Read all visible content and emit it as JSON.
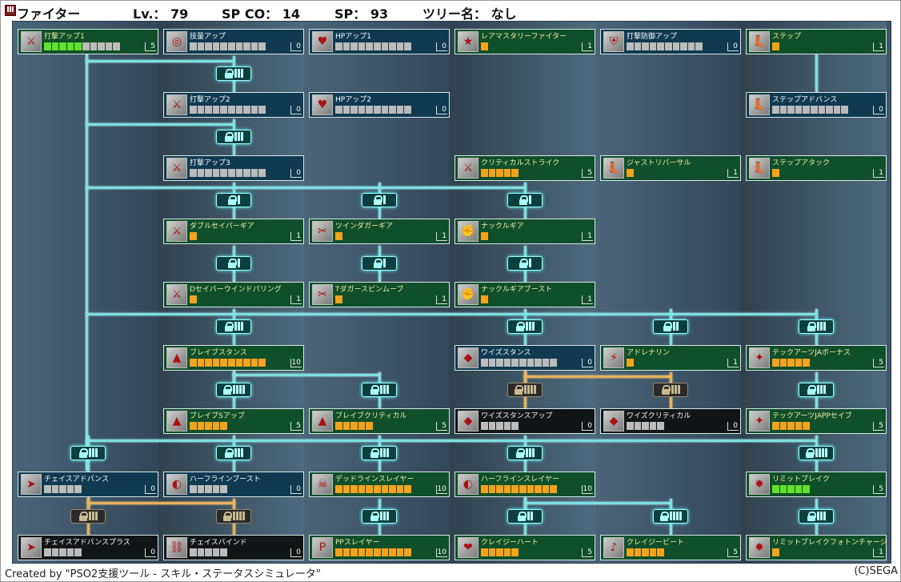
{
  "header": {
    "class_icon": "fighter-class-icon",
    "class_name": "ファイター",
    "level": "Lv.： 79",
    "sp_co": "SP CO： 14",
    "sp": "SP： 93",
    "tree_name": "ツリー名： なし"
  },
  "colors": {
    "background": "#3f5466",
    "skill_active": "#0f4f2a",
    "skill_inactive": "#0f3a50",
    "skill_locked": "#111516",
    "connector": "#7be0e0",
    "connector_locked": "#e6b35a",
    "pip_on": "#f5a21c",
    "pip_lime": "#62e02a",
    "pip_off": "#bcbcbc"
  },
  "skills": [
    {
      "id": "s1",
      "name": "打撃アップ1",
      "max": 10,
      "on": 5,
      "level": "5",
      "style": "green",
      "pip": "lime",
      "icon": "sword-icon",
      "col": 0,
      "row": 0
    },
    {
      "id": "s2",
      "name": "技量アップ",
      "max": 10,
      "on": 0,
      "level": "0",
      "style": "blue",
      "pip": "on",
      "icon": "target-icon",
      "col": 1,
      "row": 0
    },
    {
      "id": "s3",
      "name": "HPアップ1",
      "max": 10,
      "on": 0,
      "level": "0",
      "style": "blue",
      "pip": "on",
      "icon": "hp-icon",
      "col": 2,
      "row": 0
    },
    {
      "id": "s4",
      "name": "レアマスタリーファイター",
      "max": 1,
      "on": 1,
      "level": "1",
      "style": "green",
      "pip": "on",
      "icon": "star-sword-icon",
      "col": 3,
      "row": 0
    },
    {
      "id": "s5",
      "name": "打撃防御アップ",
      "max": 10,
      "on": 0,
      "level": "0",
      "style": "blue",
      "pip": "on",
      "icon": "shield-sword-icon",
      "col": 4,
      "row": 0
    },
    {
      "id": "s6",
      "name": "ステップ",
      "max": 1,
      "on": 1,
      "level": "1",
      "style": "green",
      "pip": "on",
      "icon": "step-icon",
      "col": 5,
      "row": 0
    },
    {
      "id": "s7",
      "name": "打撃アップ2",
      "max": 10,
      "on": 0,
      "level": "0",
      "style": "blue",
      "pip": "on",
      "icon": "sword-icon",
      "col": 1,
      "row": 1
    },
    {
      "id": "s8",
      "name": "HPアップ2",
      "max": 10,
      "on": 0,
      "level": "0",
      "style": "blue",
      "pip": "on",
      "icon": "hp-icon",
      "col": 2,
      "row": 1
    },
    {
      "id": "s9",
      "name": "ステップアドバンス",
      "max": 10,
      "on": 0,
      "level": "0",
      "style": "blue",
      "pip": "on",
      "icon": "step-icon",
      "col": 5,
      "row": 1
    },
    {
      "id": "s10",
      "name": "打撃アップ3",
      "max": 10,
      "on": 0,
      "level": "0",
      "style": "blue",
      "pip": "on",
      "icon": "sword-icon",
      "col": 1,
      "row": 2
    },
    {
      "id": "s11",
      "name": "クリティカルストライク",
      "max": 5,
      "on": 5,
      "level": "5",
      "style": "green",
      "pip": "on",
      "icon": "sword-icon",
      "col": 3,
      "row": 2
    },
    {
      "id": "s12",
      "name": "ジャストリバーサル",
      "max": 1,
      "on": 1,
      "level": "1",
      "style": "green",
      "pip": "on",
      "icon": "step-icon",
      "col": 4,
      "row": 2
    },
    {
      "id": "s13",
      "name": "ステップアタック",
      "max": 1,
      "on": 1,
      "level": "1",
      "style": "green",
      "pip": "on",
      "icon": "step-icon",
      "col": 5,
      "row": 2
    },
    {
      "id": "s14",
      "name": "ダブルセイバーギア",
      "max": 1,
      "on": 1,
      "level": "1",
      "style": "green",
      "pip": "on",
      "icon": "double-saber-icon",
      "col": 1,
      "row": 3
    },
    {
      "id": "s15",
      "name": "ツインダガーギア",
      "max": 1,
      "on": 1,
      "level": "1",
      "style": "green",
      "pip": "on",
      "icon": "twin-dagger-icon",
      "col": 2,
      "row": 3
    },
    {
      "id": "s16",
      "name": "ナックルギア",
      "max": 1,
      "on": 1,
      "level": "1",
      "style": "green",
      "pip": "on",
      "icon": "knuckle-icon",
      "col": 3,
      "row": 3
    },
    {
      "id": "s17",
      "name": "Dセイバーウインドパリング",
      "max": 1,
      "on": 1,
      "level": "1",
      "style": "green",
      "pip": "on",
      "icon": "double-saber-icon",
      "col": 1,
      "row": 4
    },
    {
      "id": "s18",
      "name": "Tダガースピンムーブ",
      "max": 1,
      "on": 1,
      "level": "1",
      "style": "green",
      "pip": "on",
      "icon": "twin-dagger-icon",
      "col": 2,
      "row": 4
    },
    {
      "id": "s19",
      "name": "ナックルギアブースト",
      "max": 1,
      "on": 1,
      "level": "1",
      "style": "green",
      "pip": "on",
      "icon": "knuckle-icon",
      "col": 3,
      "row": 4
    },
    {
      "id": "s20",
      "name": "ブレイブスタンス",
      "max": 10,
      "on": 10,
      "level": "10",
      "style": "green",
      "pip": "on",
      "icon": "brave-stance-icon",
      "col": 1,
      "row": 5
    },
    {
      "id": "s21",
      "name": "ワイズスタンス",
      "max": 10,
      "on": 0,
      "level": "0",
      "style": "blue",
      "pip": "on",
      "icon": "wise-stance-icon",
      "col": 3,
      "row": 5
    },
    {
      "id": "s22",
      "name": "アドレナリン",
      "max": 1,
      "on": 1,
      "level": "1",
      "style": "green",
      "pip": "on",
      "icon": "adrenaline-icon",
      "col": 4,
      "row": 5
    },
    {
      "id": "s23",
      "name": "テックアーツJAボーナス",
      "max": 5,
      "on": 5,
      "level": "5",
      "style": "green",
      "pip": "on",
      "icon": "tech-arts-icon",
      "col": 5,
      "row": 5
    },
    {
      "id": "s24",
      "name": "ブレイブSアップ",
      "max": 5,
      "on": 5,
      "level": "5",
      "style": "green",
      "pip": "on",
      "icon": "brave-stance-icon",
      "col": 1,
      "row": 6
    },
    {
      "id": "s25",
      "name": "ブレイブクリティカル",
      "max": 5,
      "on": 5,
      "level": "5",
      "style": "green",
      "pip": "on",
      "icon": "brave-stance-icon",
      "col": 2,
      "row": 6
    },
    {
      "id": "s26",
      "name": "ワイズスタンスアップ",
      "max": 5,
      "on": 0,
      "level": "0",
      "style": "dark",
      "pip": "on",
      "icon": "wise-stance-icon",
      "col": 3,
      "row": 6
    },
    {
      "id": "s27",
      "name": "ワイズクリティカル",
      "max": 5,
      "on": 0,
      "level": "0",
      "style": "dark",
      "pip": "on",
      "icon": "wise-stance-icon",
      "col": 4,
      "row": 6
    },
    {
      "id": "s28",
      "name": "テックアーツJAPPセイブ",
      "max": 5,
      "on": 5,
      "level": "5",
      "style": "green",
      "pip": "on",
      "icon": "tech-arts-icon",
      "col": 5,
      "row": 6
    },
    {
      "id": "s29",
      "name": "チェイスアドバンス",
      "max": 5,
      "on": 0,
      "level": "0",
      "style": "blue",
      "pip": "on",
      "icon": "chase-icon",
      "col": 0,
      "row": 7
    },
    {
      "id": "s30",
      "name": "ハーフラインブースト",
      "max": 5,
      "on": 0,
      "level": "0",
      "style": "blue",
      "pip": "on",
      "icon": "halfline-icon",
      "col": 1,
      "row": 7
    },
    {
      "id": "s31",
      "name": "デッドラインスレイヤー",
      "max": 10,
      "on": 10,
      "level": "10",
      "style": "green",
      "pip": "on",
      "icon": "deadline-icon",
      "col": 2,
      "row": 7
    },
    {
      "id": "s32",
      "name": "ハーフラインスレイヤー",
      "max": 10,
      "on": 10,
      "level": "10",
      "style": "green",
      "pip": "on",
      "icon": "halfline-icon",
      "col": 3,
      "row": 7
    },
    {
      "id": "s33",
      "name": "リミットブレイク",
      "max": 5,
      "on": 5,
      "level": "5",
      "style": "green",
      "pip": "lime",
      "icon": "limit-break-icon",
      "col": 5,
      "row": 7
    },
    {
      "id": "s34",
      "name": "チェイスアドバンスプラス",
      "max": 5,
      "on": 0,
      "level": "0",
      "style": "dark",
      "pip": "on",
      "icon": "chase-icon",
      "col": 0,
      "row": 8
    },
    {
      "id": "s35",
      "name": "チェイスバインド",
      "max": 5,
      "on": 0,
      "level": "0",
      "style": "dark",
      "pip": "on",
      "icon": "chase-bind-icon",
      "col": 1,
      "row": 8
    },
    {
      "id": "s36",
      "name": "PPスレイヤー",
      "max": 10,
      "on": 10,
      "level": "10",
      "style": "green",
      "pip": "on",
      "icon": "pp-slayer-icon",
      "col": 2,
      "row": 8
    },
    {
      "id": "s37",
      "name": "クレイジーハート",
      "max": 5,
      "on": 5,
      "level": "5",
      "style": "green",
      "pip": "on",
      "icon": "crazy-heart-icon",
      "col": 3,
      "row": 8
    },
    {
      "id": "s38",
      "name": "クレイジービート",
      "max": 5,
      "on": 5,
      "level": "5",
      "style": "green",
      "pip": "on",
      "icon": "crazy-beat-icon",
      "col": 4,
      "row": 8
    },
    {
      "id": "s39",
      "name": "リミットブレイクフォトンチャージ",
      "max": 1,
      "on": 1,
      "level": "1",
      "style": "green",
      "pip": "on",
      "icon": "limit-break-icon",
      "col": 5,
      "row": 8
    }
  ],
  "locks": [
    {
      "col": 1,
      "gap": 0,
      "bars": 3,
      "state": "open"
    },
    {
      "col": 1,
      "gap": 1,
      "bars": 3,
      "state": "open"
    },
    {
      "col": 1,
      "gap": 2,
      "bars": 1,
      "state": "open"
    },
    {
      "col": 2,
      "gap": 2,
      "bars": 1,
      "state": "open"
    },
    {
      "col": 3,
      "gap": 2,
      "bars": 1,
      "state": "open"
    },
    {
      "col": 1,
      "gap": 3,
      "bars": 1,
      "state": "open"
    },
    {
      "col": 2,
      "gap": 3,
      "bars": 1,
      "state": "open"
    },
    {
      "col": 3,
      "gap": 3,
      "bars": 1,
      "state": "open"
    },
    {
      "col": 1,
      "gap": 4,
      "bars": 3,
      "state": "open"
    },
    {
      "col": 3,
      "gap": 4,
      "bars": 3,
      "state": "open"
    },
    {
      "col": 4,
      "gap": 4,
      "bars": 2,
      "state": "open"
    },
    {
      "col": 5,
      "gap": 4,
      "bars": 3,
      "state": "open"
    },
    {
      "col": 1,
      "gap": 5,
      "bars": 4,
      "state": "open"
    },
    {
      "col": 2,
      "gap": 5,
      "bars": 3,
      "state": "open"
    },
    {
      "col": 3,
      "gap": 5,
      "bars": 4,
      "state": "locked"
    },
    {
      "col": 4,
      "gap": 5,
      "bars": 3,
      "state": "locked"
    },
    {
      "col": 5,
      "gap": 5,
      "bars": 3,
      "state": "open"
    },
    {
      "col": 0,
      "gap": 6,
      "bars": 3,
      "state": "open"
    },
    {
      "col": 1,
      "gap": 6,
      "bars": 3,
      "state": "open"
    },
    {
      "col": 2,
      "gap": 6,
      "bars": 3,
      "state": "open"
    },
    {
      "col": 3,
      "gap": 6,
      "bars": 3,
      "state": "open"
    },
    {
      "col": 5,
      "gap": 6,
      "bars": 4,
      "state": "open"
    },
    {
      "col": 0,
      "gap": 7,
      "bars": 3,
      "state": "locked"
    },
    {
      "col": 1,
      "gap": 7,
      "bars": 4,
      "state": "locked"
    },
    {
      "col": 2,
      "gap": 7,
      "bars": 3,
      "state": "open"
    },
    {
      "col": 3,
      "gap": 7,
      "bars": 2,
      "state": "open"
    },
    {
      "col": 4,
      "gap": 7,
      "bars": 4,
      "state": "open"
    },
    {
      "col": 5,
      "gap": 7,
      "bars": 3,
      "state": "open"
    }
  ],
  "footer": {
    "credit": "Created by \"PSO2支援ツール  -  スキル・ステータスシミュレータ\"",
    "copyright": "(C)SEGA"
  }
}
